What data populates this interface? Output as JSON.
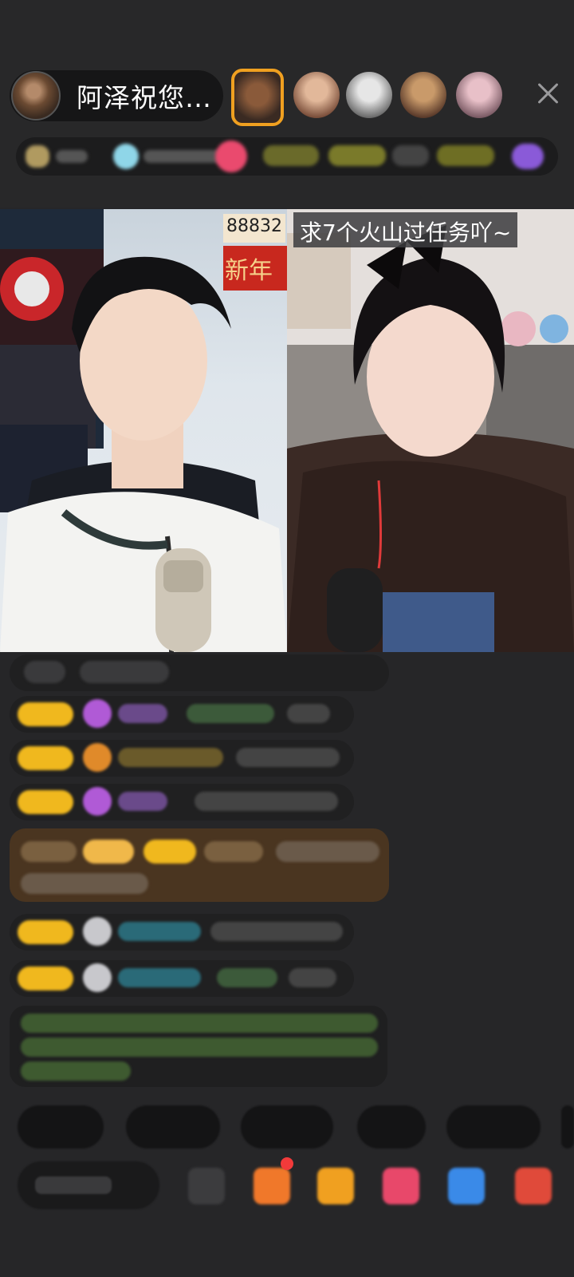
{
  "header": {
    "host_name": "阿泽祝您…"
  },
  "video": {
    "overlay_number": "88832",
    "overlay_badge": "新年",
    "task_banner": "求7个火山过任务吖~"
  },
  "colors": {
    "gold_badge": "#f0b81e",
    "purple_icon": "#b05ad6",
    "orange_icon": "#e08a2a",
    "cyan_name": "#3cc7d8",
    "green_text": "#7ac343",
    "highlight_row": "#5a4020"
  },
  "icons": [
    "close-icon",
    "gift-icon",
    "fire-icon",
    "shop-icon",
    "game-icon",
    "more-icon"
  ]
}
